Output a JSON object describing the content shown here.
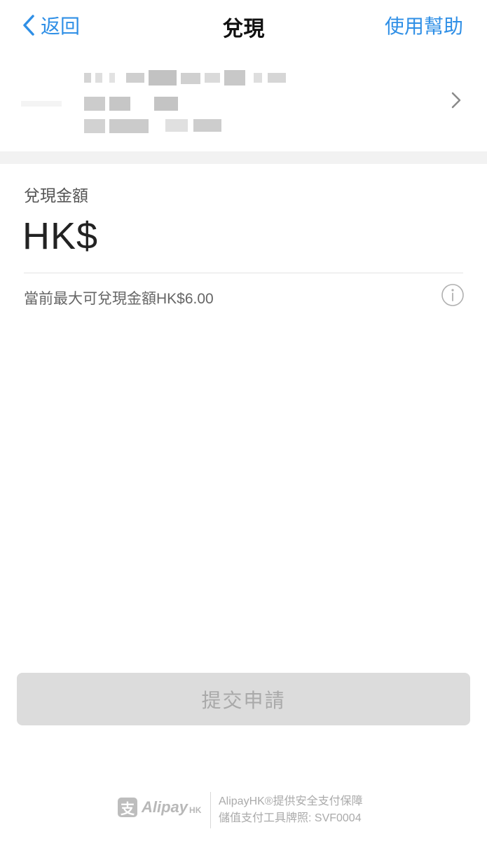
{
  "nav": {
    "back_label": "返回",
    "title": "兌現",
    "help_label": "使用幫助"
  },
  "colors": {
    "accent": "#2f8fe6",
    "disabled_button": "#dcdcdc",
    "section_gap": "#f2f2f2"
  },
  "form": {
    "amount_label": "兌現金額",
    "currency": "HK$",
    "amount_value": "",
    "max_text": "當前最大可兌現金額HK$6.00"
  },
  "submit_label": "提交申請",
  "footer": {
    "logo_mark": "支",
    "logo_word": "Alipay",
    "logo_hk": "HK",
    "line1": "AlipayHK®提供安全支付保障",
    "line2": "儲值支付工具牌照: SVF0004"
  }
}
